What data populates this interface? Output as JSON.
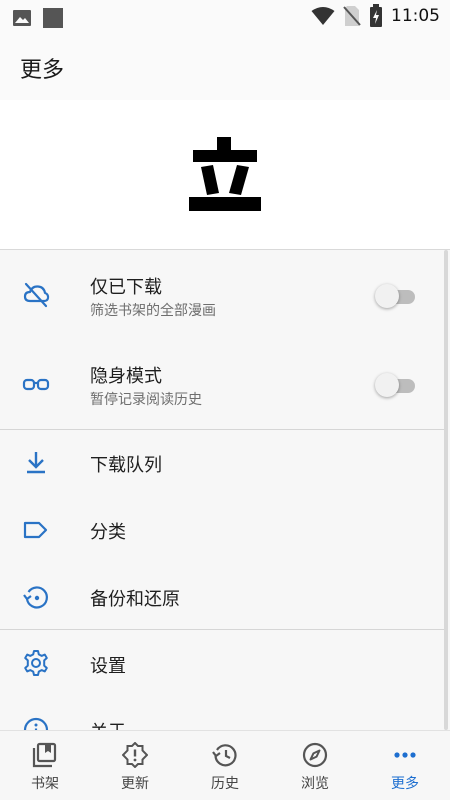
{
  "status_bar": {
    "time": "11:05"
  },
  "app_bar": {
    "title": "更多"
  },
  "logo": {
    "glyph": "立"
  },
  "menu": {
    "downloaded_only": {
      "title": "仅已下载",
      "subtitle": "筛选书架的全部漫画",
      "enabled": false,
      "icon": "cloud-off-icon"
    },
    "incognito": {
      "title": "隐身模式",
      "subtitle": "暂停记录阅读历史",
      "enabled": false,
      "icon": "glasses-icon"
    },
    "download_queue": {
      "title": "下载队列",
      "icon": "download-icon"
    },
    "categories": {
      "title": "分类",
      "icon": "label-icon"
    },
    "backup_restore": {
      "title": "备份和还原",
      "icon": "restore-icon"
    },
    "settings": {
      "title": "设置",
      "icon": "gear-icon"
    },
    "about": {
      "title": "关于",
      "icon": "info-icon"
    }
  },
  "bottom_nav": {
    "items": [
      {
        "label": "书架",
        "icon": "library-icon",
        "active": false
      },
      {
        "label": "更新",
        "icon": "alert-badge-icon",
        "active": false
      },
      {
        "label": "历史",
        "icon": "history-icon",
        "active": false
      },
      {
        "label": "浏览",
        "icon": "compass-icon",
        "active": false
      },
      {
        "label": "更多",
        "icon": "more-horiz-icon",
        "active": true
      }
    ]
  },
  "colors": {
    "accent": "#1e6fd0",
    "icon": "#2a73c5",
    "background": "#f5f5f5"
  }
}
